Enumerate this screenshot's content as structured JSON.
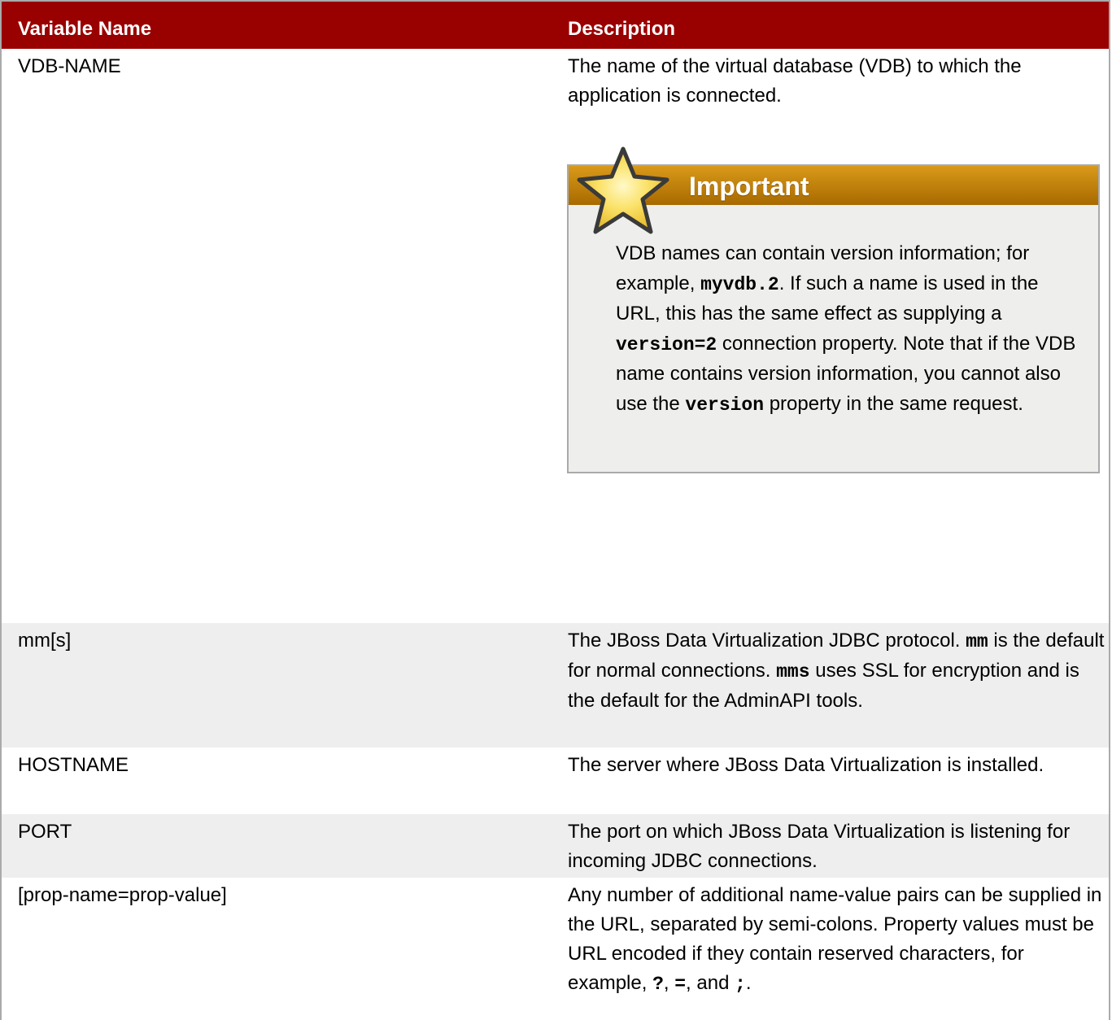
{
  "header": {
    "col1": "Variable Name",
    "col2": "Description"
  },
  "rows": [
    {
      "name": "VDB-NAME",
      "desc": "The name of the virtual database (VDB) to which the application is connected."
    },
    {
      "name": "mm[s]",
      "desc_p1": "The JBoss Data Virtualization JDBC protocol. ",
      "desc_code1": "mm",
      "desc_p2": " is the default for normal connections. ",
      "desc_code2": "mms",
      "desc_p3": " uses SSL for encryption and is the default for the AdminAPI tools."
    },
    {
      "name": "HOSTNAME",
      "desc": "The server where JBoss Data Virtualization is installed."
    },
    {
      "name": "PORT",
      "desc": "The port on which JBoss Data Virtualization is listening for incoming JDBC connections."
    },
    {
      "name": "[prop-name=prop-value]",
      "desc_p1": "Any number of additional name-value pairs can be supplied in the URL, separated by semi-colons. Property values must be URL encoded if they contain reserved characters, for example, ",
      "desc_code1": "?",
      "desc_p2": ", ",
      "desc_code2": "=",
      "desc_p3": ", and ",
      "desc_code3": ";",
      "desc_p4": "."
    }
  ],
  "important": {
    "icon": "star-icon",
    "title": "Important",
    "p1": "VDB names can contain version information; for example, ",
    "code1": "myvdb.2",
    "p2": ". If such a name is used in the URL, this has the same effect as supplying a ",
    "code2": "version=2",
    "p3": " connection property. Note that if the VDB name contains version information, you cannot also use the ",
    "code3": "version",
    "p4": " property in the same request."
  },
  "colors": {
    "header_bg": "#990000",
    "alt_row_bg": "#eeeeee",
    "admonition_bar": "#c07e10"
  }
}
